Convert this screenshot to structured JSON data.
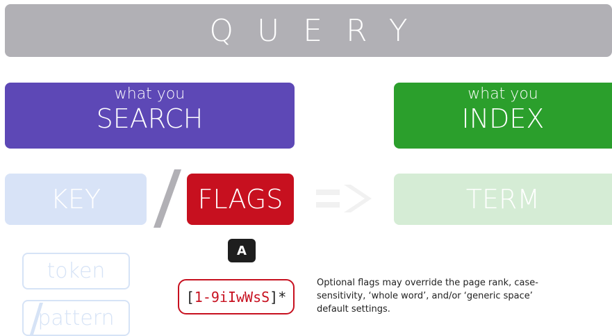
{
  "banner": {
    "title": "QUERY"
  },
  "search_box": {
    "small": "what you",
    "big": "SEARCH"
  },
  "index_box": {
    "small": "what you",
    "big": "INDEX"
  },
  "tiles": {
    "key": "KEY",
    "flags": "FLAGS",
    "term": "TERM"
  },
  "tags": {
    "token": "token",
    "pattern": "pattern"
  },
  "badge": {
    "label": "A"
  },
  "regex": {
    "open": "[",
    "inner": "1-9iIwWsS",
    "close": "]*"
  },
  "note": {
    "text": "Optional flags may override the page rank, case-sensitivity, ‘whole word’, and/or ‘generic space’ default settings."
  },
  "colors": {
    "banner": "#b1b0b5",
    "search": "#5d48b6",
    "index": "#2b9f2c",
    "key": "#d8e3f7",
    "flags": "#c7101f",
    "term": "#d5ecd5",
    "arrow": "#f1f1f1",
    "slash": "#b1b0b5"
  },
  "icons": {
    "slash": "slash-icon",
    "arrow": "double-arrow-icon"
  }
}
